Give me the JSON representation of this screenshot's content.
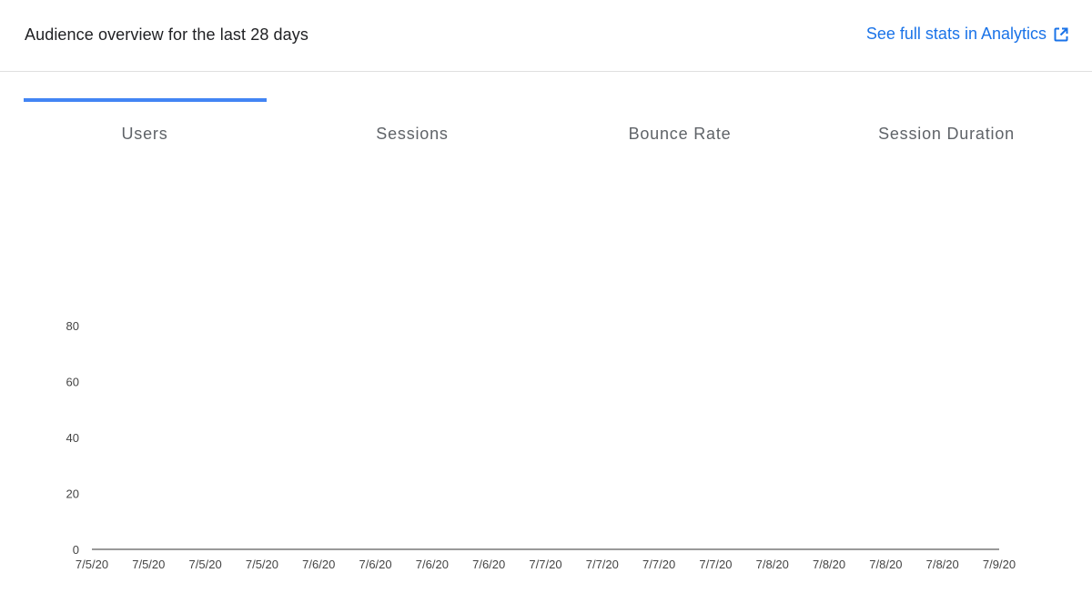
{
  "header": {
    "title": "Audience overview for the last 28 days",
    "link_label": "See full stats in Analytics",
    "link_icon": "external-link-icon",
    "link_color": "#1a73e8"
  },
  "tabs": [
    {
      "label": "Users",
      "selected": true
    },
    {
      "label": "Sessions",
      "selected": false
    },
    {
      "label": "Bounce Rate",
      "selected": false
    },
    {
      "label": "Session Duration",
      "selected": false
    }
  ],
  "accent_color": "#4285f4",
  "chart_data": {
    "type": "line",
    "series": [
      {
        "values": [
          0,
          0,
          0,
          0,
          0,
          0,
          0,
          0,
          0,
          0,
          0,
          0,
          0,
          0,
          0,
          0,
          0
        ]
      }
    ],
    "categories": [
      "7/5/20",
      "7/5/20",
      "7/5/20",
      "7/5/20",
      "7/6/20",
      "7/6/20",
      "7/6/20",
      "7/6/20",
      "7/7/20",
      "7/7/20",
      "7/7/20",
      "7/7/20",
      "7/8/20",
      "7/8/20",
      "7/8/20",
      "7/8/20",
      "7/9/20"
    ],
    "y_ticks": [
      0,
      20,
      40,
      60,
      80
    ],
    "ylim": [
      0,
      80
    ],
    "grid": false
  }
}
